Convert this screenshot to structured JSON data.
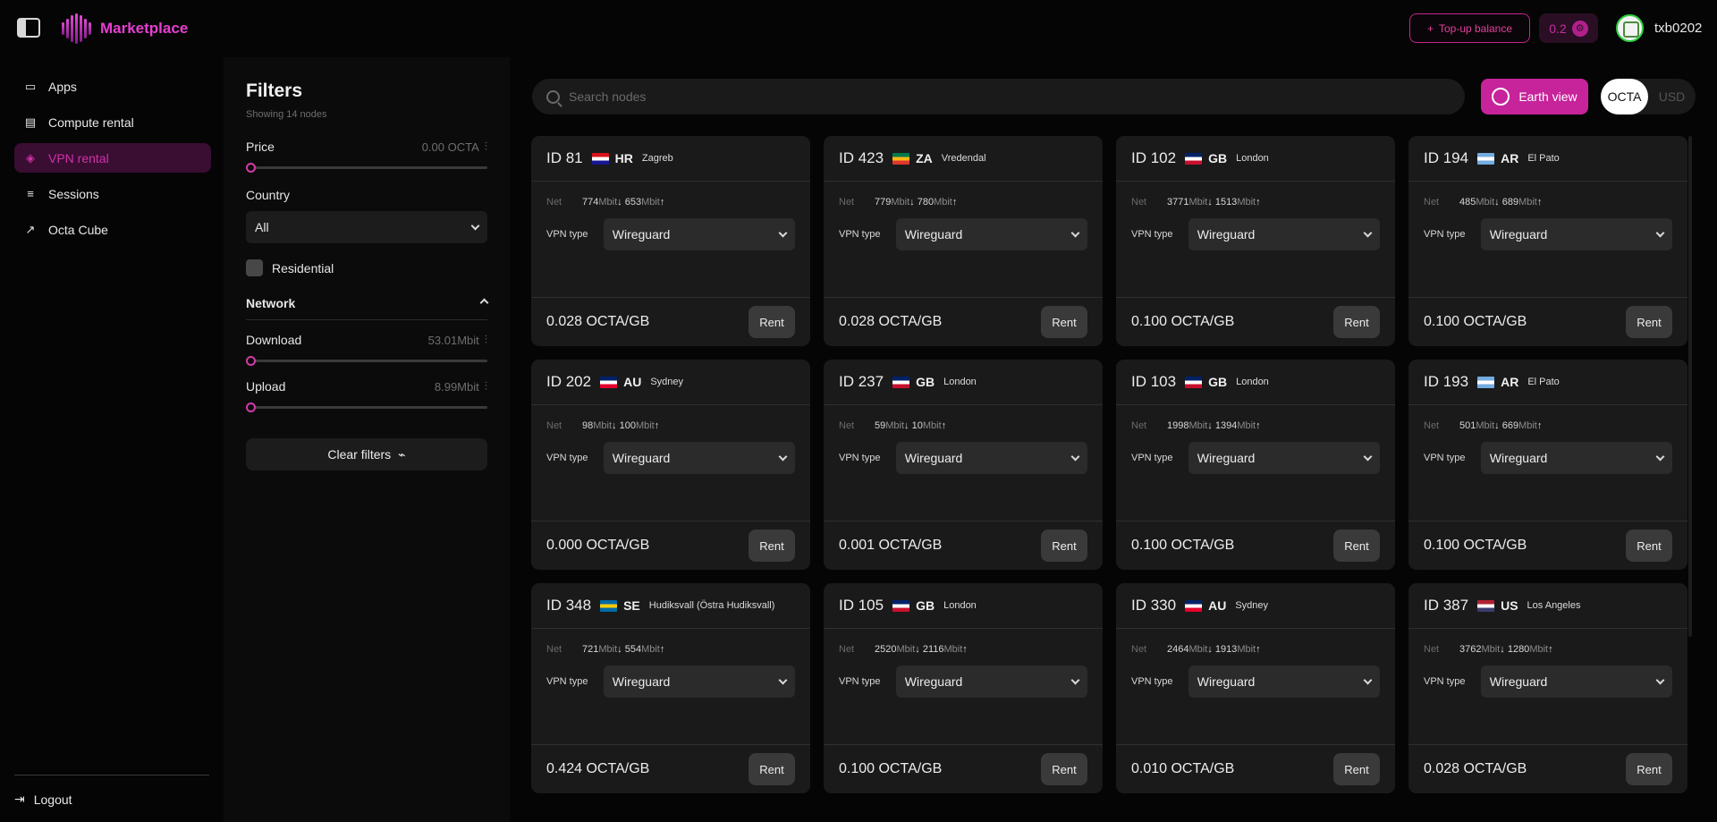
{
  "app": {
    "title": "Marketplace"
  },
  "topbar": {
    "topup_label": "Top-up balance",
    "balance": "0.2",
    "username": "txb0202"
  },
  "nav": {
    "items": [
      {
        "label": "Apps",
        "icon": "app-window-icon",
        "active": false
      },
      {
        "label": "Compute rental",
        "icon": "server-icon",
        "active": false
      },
      {
        "label": "VPN rental",
        "icon": "vpn-icon",
        "active": true
      },
      {
        "label": "Sessions",
        "icon": "list-icon",
        "active": false
      },
      {
        "label": "Octa Cube",
        "icon": "external-link-icon",
        "active": false
      }
    ],
    "logout_label": "Logout"
  },
  "filters": {
    "title": "Filters",
    "showing": "Showing 14 nodes",
    "price_label": "Price",
    "price_value": "0.00 OCTA",
    "country_label": "Country",
    "country_value": "All",
    "residential_label": "Residential",
    "network_label": "Network",
    "download_label": "Download",
    "download_value": "53.01Mbit",
    "upload_label": "Upload",
    "upload_value": "8.99Mbit",
    "clear_label": "Clear filters"
  },
  "search": {
    "placeholder": "Search nodes"
  },
  "earth_view_label": "Earth view",
  "currency": {
    "options": [
      "OCTA",
      "USD"
    ],
    "selected": "OCTA"
  },
  "colors": {
    "accent": "#c7239a",
    "background": "#050505",
    "card": "#1a1a1a"
  },
  "card_labels": {
    "net": "Net",
    "vpn_type": "VPN type",
    "rent": "Rent"
  },
  "nodes": [
    {
      "id": "ID 81",
      "cc": "HR",
      "city": "Zagreb",
      "down": "774",
      "up": "653",
      "vpn": "Wireguard",
      "price": "0.028 OCTA/GB"
    },
    {
      "id": "ID 423",
      "cc": "ZA",
      "city": "Vredendal",
      "down": "779",
      "up": "780",
      "vpn": "Wireguard",
      "price": "0.028 OCTA/GB"
    },
    {
      "id": "ID 102",
      "cc": "GB",
      "city": "London",
      "down": "3771",
      "up": "1513",
      "vpn": "Wireguard",
      "price": "0.100 OCTA/GB"
    },
    {
      "id": "ID 194",
      "cc": "AR",
      "city": "El Pato",
      "down": "485",
      "up": "689",
      "vpn": "Wireguard",
      "price": "0.100 OCTA/GB"
    },
    {
      "id": "ID 202",
      "cc": "AU",
      "city": "Sydney",
      "down": "98",
      "up": "100",
      "vpn": "Wireguard",
      "price": "0.000 OCTA/GB"
    },
    {
      "id": "ID 237",
      "cc": "GB",
      "city": "London",
      "down": "59",
      "up": "10",
      "vpn": "Wireguard",
      "price": "0.001 OCTA/GB"
    },
    {
      "id": "ID 103",
      "cc": "GB",
      "city": "London",
      "down": "1998",
      "up": "1394",
      "vpn": "Wireguard",
      "price": "0.100 OCTA/GB"
    },
    {
      "id": "ID 193",
      "cc": "AR",
      "city": "El Pato",
      "down": "501",
      "up": "669",
      "vpn": "Wireguard",
      "price": "0.100 OCTA/GB"
    },
    {
      "id": "ID 348",
      "cc": "SE",
      "city": "Hudiksvall (Östra Hudiksvall)",
      "down": "721",
      "up": "554",
      "vpn": "Wireguard",
      "price": "0.424 OCTA/GB"
    },
    {
      "id": "ID 105",
      "cc": "GB",
      "city": "London",
      "down": "2520",
      "up": "2116",
      "vpn": "Wireguard",
      "price": "0.100 OCTA/GB"
    },
    {
      "id": "ID 330",
      "cc": "AU",
      "city": "Sydney",
      "down": "2464",
      "up": "1913",
      "vpn": "Wireguard",
      "price": "0.010 OCTA/GB"
    },
    {
      "id": "ID 387",
      "cc": "US",
      "city": "Los Angeles",
      "down": "3762",
      "up": "1280",
      "vpn": "Wireguard",
      "price": "0.028 OCTA/GB"
    }
  ],
  "flag_colors": {
    "HR": [
      "#d7141a",
      "#ffffff",
      "#171796"
    ],
    "ZA": [
      "#007a4d",
      "#ffb612",
      "#de3831"
    ],
    "GB": [
      "#012169",
      "#ffffff",
      "#c8102e"
    ],
    "AR": [
      "#74acdf",
      "#ffffff",
      "#74acdf"
    ],
    "AU": [
      "#012169",
      "#ffffff",
      "#e4002b"
    ],
    "SE": [
      "#006aa7",
      "#fecc00",
      "#006aa7"
    ],
    "US": [
      "#b22234",
      "#ffffff",
      "#3c3b6e"
    ]
  }
}
